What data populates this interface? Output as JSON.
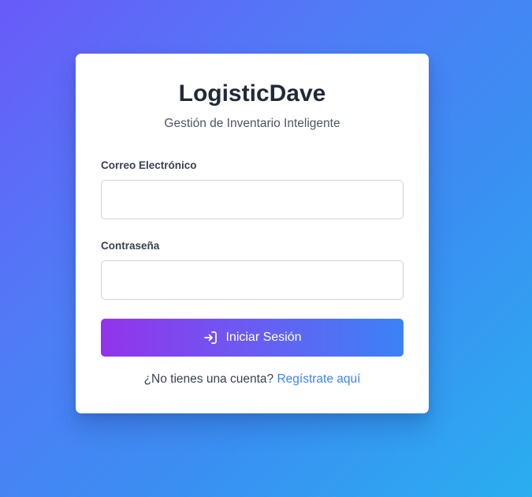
{
  "app": {
    "title": "LogisticDave",
    "subtitle": "Gestión de Inventario Inteligente"
  },
  "form": {
    "email_label": "Correo Electrónico",
    "email_value": "",
    "email_placeholder": "",
    "password_label": "Contraseña",
    "password_value": "",
    "password_placeholder": "",
    "submit_label": "Iniciar Sesión",
    "submit_icon": "login-arrow-icon"
  },
  "register": {
    "prompt": "¿No tienes una cuenta?",
    "link_label": "Regístrate aquí"
  },
  "colors": {
    "background_start": "#6a5af9",
    "background_end": "#2aaef0",
    "button_start": "#9333ea",
    "button_end": "#3b82f6",
    "link": "#3b82f6",
    "title": "#1f2937"
  }
}
